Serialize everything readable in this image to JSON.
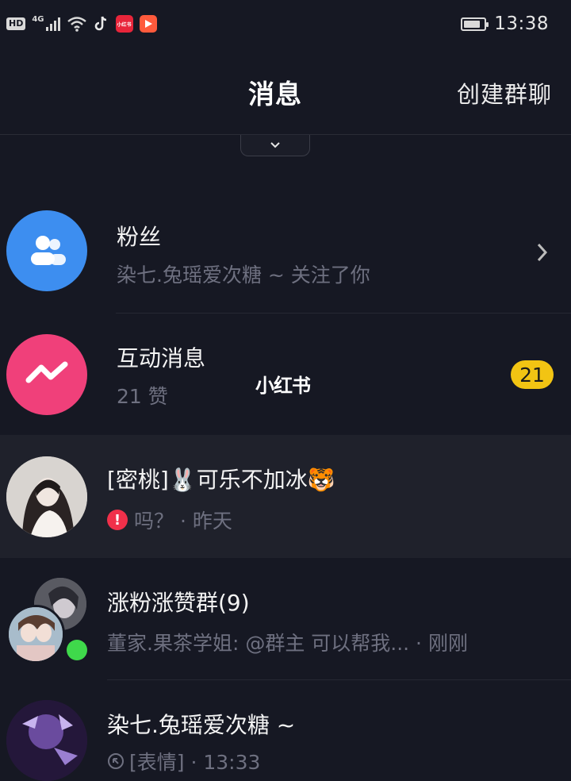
{
  "status_bar": {
    "hd": "HD",
    "network": "4G",
    "app1_label": "小红书",
    "time": "13:38"
  },
  "header": {
    "title": "消息",
    "create_group": "创建群聊"
  },
  "watermark": "小红书",
  "rows": [
    {
      "title": "粉丝",
      "subtitle": "染七.兔瑶爱次糖 ~ 关注了你",
      "avatar_color": "#3d8ef0",
      "icon": "fans-icon"
    },
    {
      "title": "互动消息",
      "subtitle": "21 赞",
      "avatar_color": "#f0407a",
      "icon": "interaction-icon",
      "badge": "21"
    },
    {
      "title_prefix": "[密桃]",
      "title_mid": "可乐不加冰",
      "emoji1": "🐰",
      "emoji2": "🐯",
      "subtitle": "吗？ · 昨天",
      "status": "error"
    },
    {
      "title": "涨粉涨赞群(9)",
      "subtitle": "董家.果茶学姐: @群主 可以帮我... · 刚刚",
      "online": true
    },
    {
      "title": "染七.兔瑶爱次糖 ~",
      "subtitle": "[表情] · 13:33"
    }
  ],
  "colors": {
    "background": "#161823",
    "highlight_row": "#1f212b",
    "badge": "#f2c413",
    "online_dot": "#3fd94b",
    "error": "#f0304a"
  }
}
